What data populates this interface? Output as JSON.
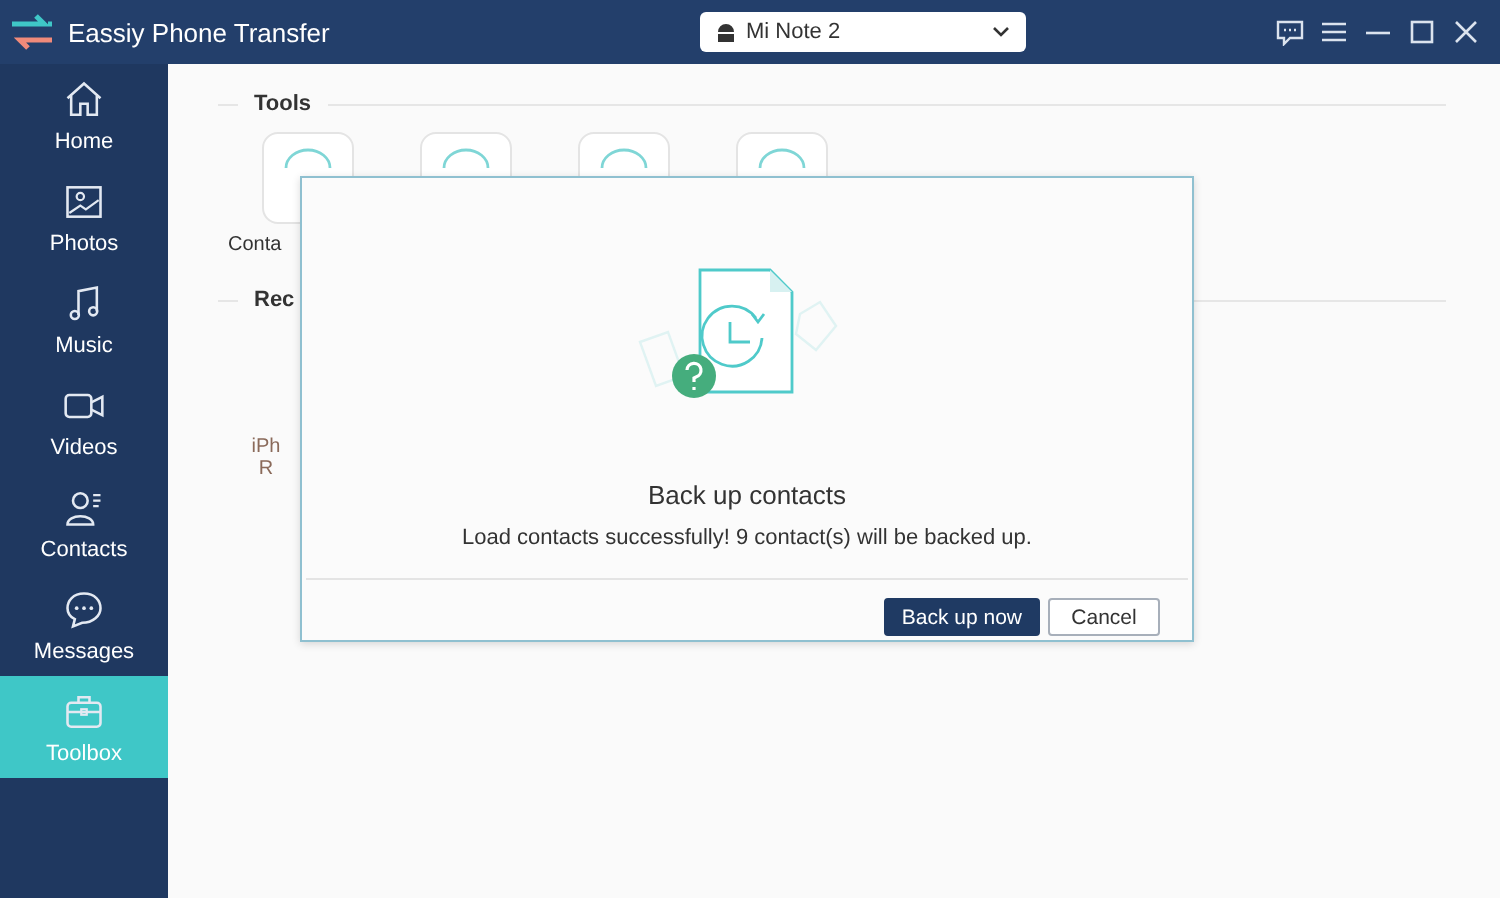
{
  "window": {
    "title": "Eassiy Phone Transfer"
  },
  "device_selector": {
    "value": "Mi Note 2"
  },
  "sidebar": {
    "items": [
      {
        "label": "Home",
        "selected": false
      },
      {
        "label": "Photos",
        "selected": false
      },
      {
        "label": "Music",
        "selected": false
      },
      {
        "label": "Videos",
        "selected": false
      },
      {
        "label": "Contacts",
        "selected": false
      },
      {
        "label": "Messages",
        "selected": false
      },
      {
        "label": "Toolbox",
        "selected": true
      }
    ]
  },
  "tools": {
    "heading": "Tools",
    "first_tile_label": "Conta"
  },
  "recent": {
    "heading": "Rec",
    "item_label_lines": [
      "iPh",
      "R"
    ]
  },
  "dialog": {
    "title": "Back up contacts",
    "message": "Load contacts successfully! 9 contact(s) will be backed up.",
    "buttons": [
      {
        "label": "Back up now",
        "kind": "primary"
      },
      {
        "label": "Cancel",
        "kind": "secondary"
      }
    ]
  }
}
